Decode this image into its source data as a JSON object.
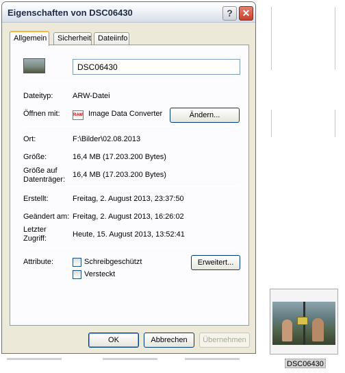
{
  "window": {
    "title": "Eigenschaften von DSC06430",
    "help_label": "?",
    "close_label": "✕"
  },
  "tabs": [
    {
      "label": "Allgemein",
      "active": true
    },
    {
      "label": "Sicherheit",
      "active": false
    },
    {
      "label": "Dateiinfo",
      "active": false
    }
  ],
  "general": {
    "file_name": "DSC06430",
    "type_label": "Dateityp:",
    "type_value": "ARW-Datei",
    "open_with_label": "Öffnen mit:",
    "open_with_icon_text": "RAW",
    "open_with_value": "Image Data Converter",
    "change_button": "Ändern...",
    "location_label": "Ort:",
    "location_value": "F:\\Bilder\\02.08.2013",
    "size_label": "Größe:",
    "size_value": "16,4 MB (17.203.200 Bytes)",
    "disk_size_label_1": "Größe auf",
    "disk_size_label_2": "Datenträger:",
    "disk_size_value": "16,4 MB (17.203.200 Bytes)",
    "created_label": "Erstellt:",
    "created_value": "Freitag, 2. August 2013, 23:37:50",
    "modified_label": "Geändert am:",
    "modified_value": "Freitag, 2. August 2013, 16:26:02",
    "accessed_label_1": "Letzter",
    "accessed_label_2": "Zugriff:",
    "accessed_value": "Heute, 15. August 2013, 13:52:41",
    "attributes_label": "Attribute:",
    "readonly_label": "Schreibgeschützt",
    "hidden_label": "Versteckt",
    "advanced_button": "Erweitert..."
  },
  "footer": {
    "ok": "OK",
    "cancel": "Abbrechen",
    "apply": "Übernehmen"
  },
  "desktop": {
    "thumbnail_caption": "DSC06430"
  }
}
